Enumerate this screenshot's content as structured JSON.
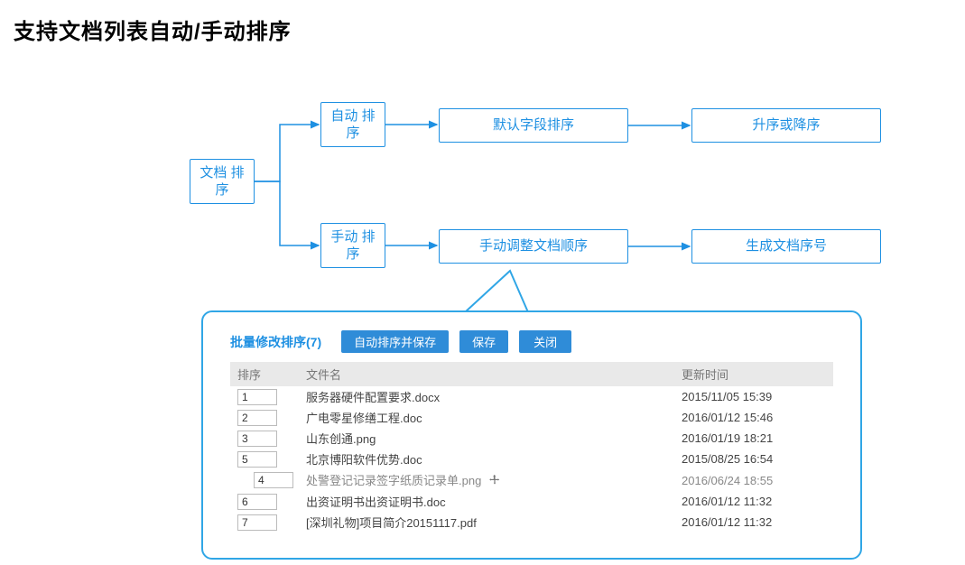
{
  "title": "支持文档列表自动/手动排序",
  "nodes": {
    "root": "文档\n排序",
    "auto": "自动\n排序",
    "manual": "手动\n排序",
    "defaultField": "默认字段排序",
    "ascDesc": "升序或降序",
    "adjustOrder": "手动调整文档顺序",
    "genSeq": "生成文档序号"
  },
  "panel": {
    "title": "批量修改排序(7)",
    "buttons": {
      "autoSave": "自动排序并保存",
      "save": "保存",
      "close": "关闭"
    },
    "columns": {
      "sort": "排序",
      "name": "文件名",
      "time": "更新时间"
    },
    "rows": [
      {
        "sort": "1",
        "name": "服务器硬件配置要求.docx",
        "time": "2015/11/05 15:39"
      },
      {
        "sort": "2",
        "name": "广电零星修缮工程.doc",
        "time": "2016/01/12 15:46"
      },
      {
        "sort": "3",
        "name": "山东创通.png",
        "time": "2016/01/19 18:21"
      },
      {
        "sort": "5",
        "name": "北京博阳软件优势.doc",
        "time": "2015/08/25 16:54"
      }
    ],
    "dragRow": {
      "sort": "4",
      "name": "处警登记记录签字纸质记录单.png",
      "time": "2016/06/24 18:55"
    },
    "afterRows": [
      {
        "sort": "6",
        "name": "出资证明书出资证明书.doc",
        "time": "2016/01/12 11:32"
      },
      {
        "sort": "7",
        "name": "[深圳礼物]项目简介20151117.pdf",
        "time": "2016/01/12 11:32"
      }
    ]
  }
}
